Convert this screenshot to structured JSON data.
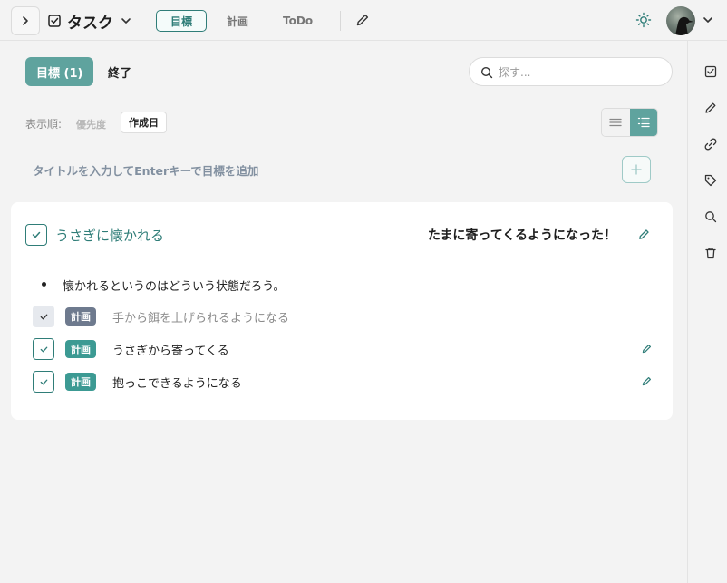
{
  "header": {
    "title": "タスク",
    "tabs": [
      {
        "label": "目標",
        "active": true
      },
      {
        "label": "計画",
        "active": false
      },
      {
        "label": "ToDo",
        "active": false
      }
    ]
  },
  "filters": {
    "goal_pill": "目標 (1)",
    "done_pill": "終了",
    "search_placeholder": "探す..."
  },
  "sort": {
    "label": "表示順:",
    "options": [
      "優先度",
      "作成日"
    ],
    "selected": "作成日"
  },
  "add": {
    "placeholder": "タイトルを入力してEnterキーで目標を追加"
  },
  "goal": {
    "title": "うさぎに懐かれる",
    "note": "たまに寄ってくるようになった！",
    "bullet": "懐かれるというのはどういう状態だろう。",
    "plans": [
      {
        "tag": "計画",
        "text": "手から餌を上げられるようになる",
        "status": "done"
      },
      {
        "tag": "計画",
        "text": "うさぎから寄ってくる",
        "status": "open"
      },
      {
        "tag": "計画",
        "text": "抱っこできるようになる",
        "status": "open"
      }
    ]
  },
  "rail_icons": [
    "checkbox-icon",
    "pencil-icon",
    "link-icon",
    "tag-icon",
    "search-icon",
    "trash-icon"
  ],
  "colors": {
    "accent": "#2f7d78",
    "accent_fill": "#5fa39e",
    "tag_open": "#3c9a93",
    "tag_done": "#6e7a8e",
    "background": "#f3f3f3"
  }
}
